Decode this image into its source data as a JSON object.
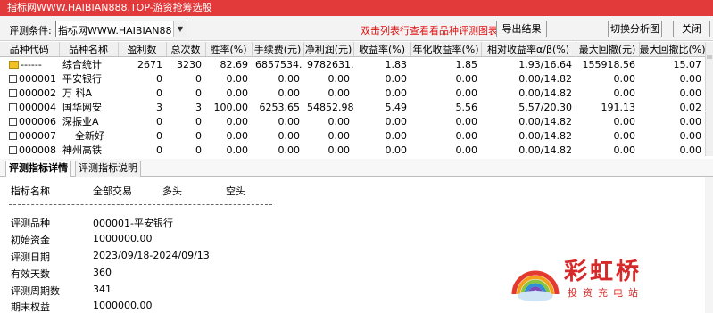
{
  "title": "指标网WWW.HAIBIAN888.TOP-游资抢筹选股",
  "toolbar": {
    "condition_label": "评测条件:",
    "condition_value": "指标网WWW.HAIBIAN888.TOP",
    "hint": "双击列表行查看看品种评测图表",
    "export_button": "导出结果",
    "switch_button": "切换分析图",
    "close_button": "关闭"
  },
  "grid": {
    "headers": [
      "品种代码",
      "品种名称",
      "盈利数",
      "总次数",
      "胜率(%)",
      "手续费(元)",
      "净利润(元)",
      "收益率(%)",
      "年化收益率(%)",
      "相对收益率α/β(%)",
      "最大回撤(元)",
      "最大回撤比(%)"
    ],
    "rows": [
      [
        "------",
        "综合统计",
        "2671",
        "3230",
        "82.69",
        "6857534...",
        "9782631...",
        "1.83",
        "1.85",
        "1.93/16.64",
        "155918.56",
        "15.07"
      ],
      [
        "000001",
        "平安银行",
        "0",
        "0",
        "0.00",
        "0.00",
        "0.00",
        "0.00",
        "0.00",
        "0.00/14.82",
        "0.00",
        "0.00"
      ],
      [
        "000002",
        "万 科A",
        "0",
        "0",
        "0.00",
        "0.00",
        "0.00",
        "0.00",
        "0.00",
        "0.00/14.82",
        "0.00",
        "0.00"
      ],
      [
        "000004",
        "国华网安",
        "3",
        "3",
        "100.00",
        "6253.65",
        "54852.98",
        "5.49",
        "5.56",
        "5.57/20.30",
        "191.13",
        "0.02"
      ],
      [
        "000006",
        "深振业A",
        "0",
        "0",
        "0.00",
        "0.00",
        "0.00",
        "0.00",
        "0.00",
        "0.00/14.82",
        "0.00",
        "0.00"
      ],
      [
        "000007",
        "全新好",
        "0",
        "0",
        "0.00",
        "0.00",
        "0.00",
        "0.00",
        "0.00",
        "0.00/14.82",
        "0.00",
        "0.00"
      ],
      [
        "000008",
        "神州高铁",
        "0",
        "0",
        "0.00",
        "0.00",
        "0.00",
        "0.00",
        "0.00",
        "0.00/14.82",
        "0.00",
        "0.00"
      ]
    ]
  },
  "tabs": [
    "评测指标详情",
    "评测指标说明"
  ],
  "detail": {
    "headers": [
      "指标名称",
      "全部交易",
      "多头",
      "空头"
    ],
    "items": [
      {
        "label": "评测品种",
        "value": "000001-平安银行"
      },
      {
        "label": "初始资金",
        "value": "1000000.00"
      },
      {
        "label": "评测日期",
        "value": "2023/09/18-2024/09/13"
      },
      {
        "label": "有效天数",
        "value": "360"
      },
      {
        "label": "评测周期数",
        "value": "341"
      },
      {
        "label": "期末权益",
        "value": "1000000.00"
      }
    ]
  },
  "watermark": {
    "name": "彩虹桥",
    "tagline": "投资充电站"
  },
  "colors": {
    "title_bar": "#e23a3a",
    "hint": "#e01010",
    "watermark": "#d62a2a"
  }
}
